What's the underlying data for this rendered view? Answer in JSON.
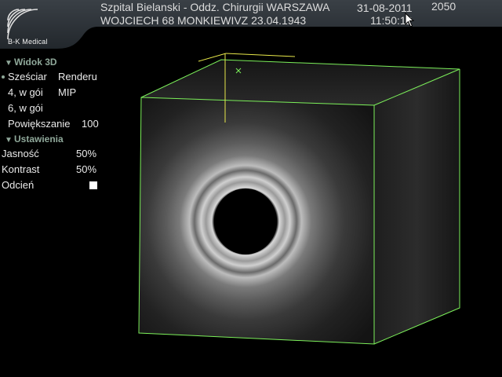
{
  "header": {
    "logo_text": "B-K Medical",
    "hospital": "Szpital Bielanski - Oddz. Chirurgii WARSZAWA",
    "patient": "WOJCIECH 68 MONKIEWIVZ  23.04.1943",
    "date": "31-08-2011",
    "time": "11:50:12",
    "probe_code": "2050"
  },
  "panel": {
    "section_3d": "Widok 3D",
    "rows": [
      {
        "label": "Sześciar",
        "value": "Renderu",
        "selected": true
      },
      {
        "label": "4, w gói",
        "value": "MIP"
      },
      {
        "label": "6, w gói",
        "value": ""
      },
      {
        "label": "Powiększanie",
        "value": "100"
      }
    ],
    "section_settings": "Ustawienia",
    "settings": [
      {
        "label": "Jasność",
        "value": "50%"
      },
      {
        "label": "Kontrast",
        "value": "50%"
      },
      {
        "label": "Odcień",
        "value": ""
      }
    ]
  },
  "colors": {
    "accent_green": "#7cf05a",
    "guide_yellow": "#e8e84a",
    "section_text": "#8fa89a",
    "header_bg": "#2b3036"
  }
}
